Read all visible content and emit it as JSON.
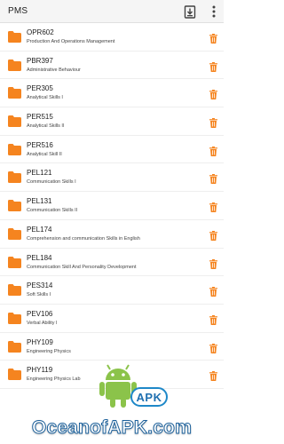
{
  "appbar": {
    "title": "PMS",
    "download_icon": "download-file-icon",
    "more_icon": "more-vertical-icon"
  },
  "colors": {
    "folder": "#f5841f",
    "trash": "#f5841f",
    "appbar_bg": "#f5f5f5"
  },
  "courses": [
    {
      "code": "OPR602",
      "name": "Production And Operations Management"
    },
    {
      "code": "PBR397",
      "name": "Administrative Behaviour"
    },
    {
      "code": "PER305",
      "name": "Analytical Skills I"
    },
    {
      "code": "PER515",
      "name": "Analytical Skills II"
    },
    {
      "code": "PER516",
      "name": "Analytical Skill II"
    },
    {
      "code": "PEL121",
      "name": "Communication Skills I"
    },
    {
      "code": "PEL131",
      "name": "Communication Skills II"
    },
    {
      "code": "PEL174",
      "name": "Comprehension and communication Skills in English"
    },
    {
      "code": "PEL184",
      "name": "Communication Skill And Personality Development"
    },
    {
      "code": "PES314",
      "name": "Soft Skills I"
    },
    {
      "code": "PEV106",
      "name": "Verbal Ability I"
    },
    {
      "code": "PHY109",
      "name": "Engineering Physics"
    },
    {
      "code": "PHY119",
      "name": "Engineering Physics Lab"
    }
  ],
  "watermark": {
    "badge": "APK",
    "text": "OceanofAPK.com"
  }
}
